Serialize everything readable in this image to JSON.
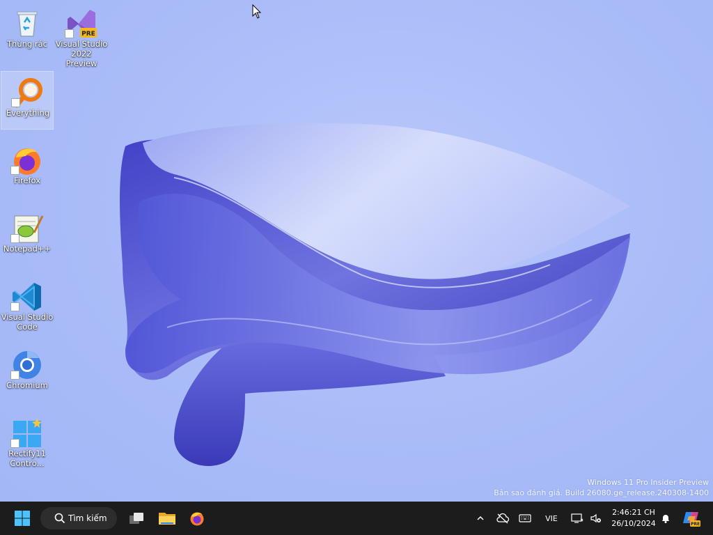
{
  "desktop": {
    "icons": [
      {
        "label": "Thùng rác"
      },
      {
        "label": "Visual Studio 2022 Preview",
        "badge": "PRE"
      },
      {
        "label": "Everything"
      },
      {
        "label": "Firefox"
      },
      {
        "label": "Notepad++"
      },
      {
        "label": "Visual Studio Code"
      },
      {
        "label": "Chromium"
      },
      {
        "label": "Rectify11 Contro..."
      }
    ]
  },
  "watermark": {
    "line1": "Windows 11 Pro Insider Preview",
    "line2": "Bản sao đánh giá. Build 26080.ge_release.240308-1400"
  },
  "taskbar": {
    "search_label": "Tìm kiếm",
    "language": "VIE",
    "time": "2:46:21 CH",
    "date": "26/10/2024",
    "copilot_badge": "PRE"
  },
  "colors": {
    "desktop_bg": "#a9bcf8",
    "ribbon_dark": "#3f3fc0",
    "ribbon_light": "#c9d3fb",
    "taskbar_bg": "#1c1c1c"
  }
}
